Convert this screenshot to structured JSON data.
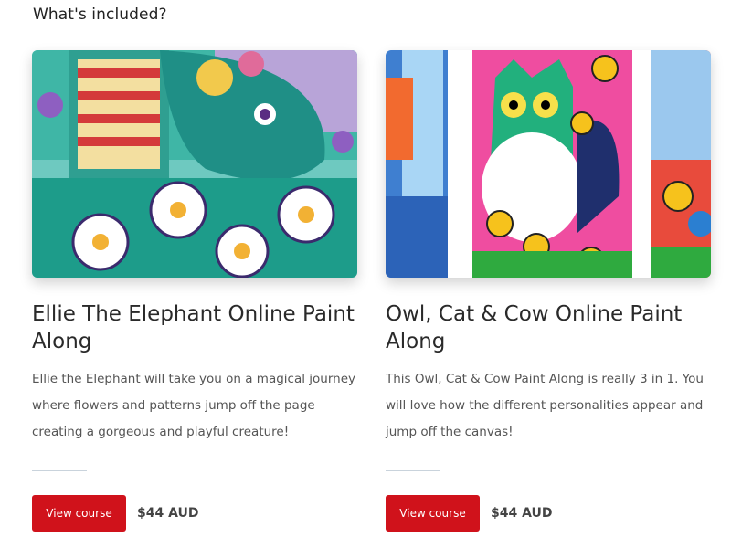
{
  "section": {
    "heading": "What's included?"
  },
  "cards": [
    {
      "title": "Ellie The Elephant Online Paint Along",
      "description": "Ellie the Elephant will take you on a magical journey where flowers and patterns jump off the page creating a gorgeous and playful creature!",
      "button_label": "View course",
      "price": "$44 AUD",
      "image": "elephant-painting"
    },
    {
      "title": "Owl, Cat & Cow Online Paint Along",
      "description": "This Owl, Cat & Cow Paint Along is really 3 in 1.  You will love how the different personalities appear and jump off the canvas!",
      "button_label": "View course",
      "price": "$44 AUD",
      "image": "owl-cat-cow-painting"
    }
  ],
  "colors": {
    "button": "#d0121b",
    "divider": "#c9d3dc"
  }
}
